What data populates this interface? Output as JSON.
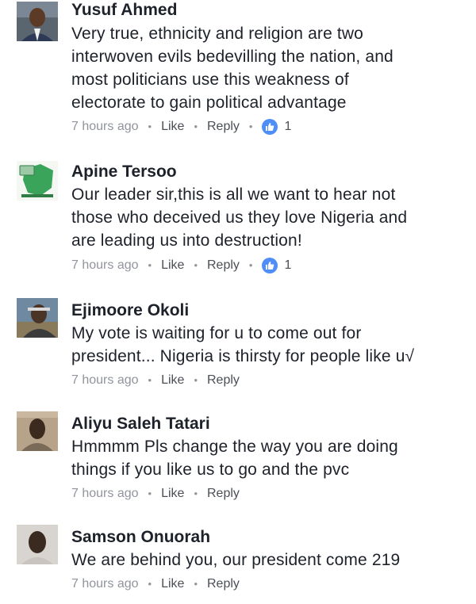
{
  "comments": [
    {
      "author": "Yusuf Ahmed",
      "lines": [
        "Very true,  ethnicity and religion are two",
        "interwoven evils bedevilling the nation,  and",
        "most politicians use this weakness of",
        "electorate to gain political advantage"
      ],
      "time": "7 hours ago",
      "like_label": "Like",
      "reply_label": "Reply",
      "reactions": "1"
    },
    {
      "author": "Apine Tersoo",
      "lines": [
        "Our leader sir,this is all we want to hear not",
        "those who deceived us they love Nigeria and",
        "are leading us into destruction!"
      ],
      "time": "7 hours ago",
      "like_label": "Like",
      "reply_label": "Reply",
      "reactions": "1"
    },
    {
      "author": "Ejimoore Okoli",
      "lines": [
        "My vote is waiting for u to come out for",
        "president... Nigeria is thirsty for people like u√"
      ],
      "time": "7 hours ago",
      "like_label": "Like",
      "reply_label": "Reply"
    },
    {
      "author": "Aliyu Saleh Tatari",
      "lines": [
        "Hmmmm Pls change the way you are doing",
        "things if you like us to go and the pvc"
      ],
      "time": "7 hours ago",
      "like_label": "Like",
      "reply_label": "Reply"
    },
    {
      "author": "Samson Onuorah",
      "lines": [
        "We are behind you, our president come 219"
      ],
      "time": "7 hours ago",
      "like_label": "Like",
      "reply_label": "Reply"
    }
  ],
  "colors": {
    "text": "#1d2129",
    "meta": "#90949c",
    "link": "#4b4f56",
    "like_badge": "#4f8ef7"
  },
  "icons": {
    "reaction": "thumbs-up-icon"
  }
}
